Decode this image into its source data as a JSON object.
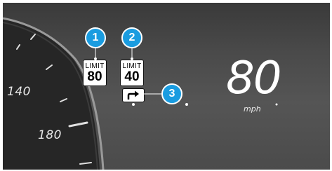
{
  "gauge": {
    "labels": [
      "140",
      "180"
    ]
  },
  "signs": {
    "current_limit": {
      "label": "LIMIT",
      "value": "80"
    },
    "upcoming_limit": {
      "label": "LIMIT",
      "value": "40"
    },
    "turn_indicator_icon": "arrow-right-turn-icon"
  },
  "speed": {
    "value": "80",
    "unit": "mph"
  },
  "callouts": [
    "1",
    "2",
    "3"
  ],
  "colors": {
    "callout": "#1a9ce0",
    "display_bg": "#4a4a4a",
    "text": "#ffffff"
  }
}
